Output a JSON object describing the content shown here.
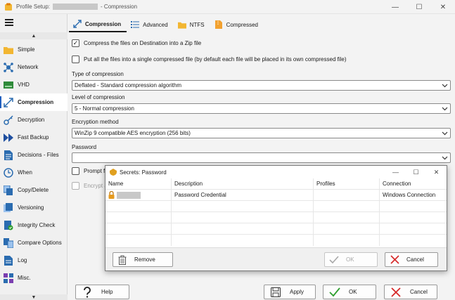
{
  "window": {
    "title_prefix": "Profile Setup:",
    "title_suffix": "- Compression",
    "minimize": "—",
    "maximize": "☐",
    "close": "✕"
  },
  "sidebar": {
    "scroll_up": "▲",
    "scroll_down": "▼",
    "items": [
      {
        "label": "Simple",
        "icon": "folder-icon"
      },
      {
        "label": "Network",
        "icon": "network-icon"
      },
      {
        "label": "VHD",
        "icon": "vhd-icon"
      },
      {
        "label": "Compression",
        "icon": "compression-icon",
        "active": true
      },
      {
        "label": "Decryption",
        "icon": "key-icon"
      },
      {
        "label": "Fast Backup",
        "icon": "fast-forward-icon"
      },
      {
        "label": "Decisions - Files",
        "icon": "document-icon"
      },
      {
        "label": "When",
        "icon": "clock-icon"
      },
      {
        "label": "Copy/Delete",
        "icon": "copy-icon"
      },
      {
        "label": "Versioning",
        "icon": "versioning-icon"
      },
      {
        "label": "Integrity Check",
        "icon": "integrity-icon"
      },
      {
        "label": "Compare Options",
        "icon": "compare-icon"
      },
      {
        "label": "Log",
        "icon": "log-icon"
      },
      {
        "label": "Misc.",
        "icon": "misc-icon"
      }
    ]
  },
  "tabs": [
    {
      "label": "Compression",
      "active": true
    },
    {
      "label": "Advanced"
    },
    {
      "label": "NTFS"
    },
    {
      "label": "Compressed"
    }
  ],
  "compression": {
    "zip_checkbox_label": "Compress the files on Destination into a Zip file",
    "zip_checked": true,
    "single_file_label": "Put all the files into a single compressed file (by default each file will be placed in its own compressed file)",
    "single_file_checked": false,
    "type_label": "Type of compression",
    "type_value": "Deflated - Standard compression algorithm",
    "level_label": "Level of compression",
    "level_value": "5 - Normal compression",
    "encryption_label": "Encryption method",
    "encryption_value": "WinZip 9 compatible AES encryption (256 bits)",
    "password_label": "Password",
    "password_value": "",
    "prompt_label": "Prompt fo",
    "encrypt_label": "Encrypt an"
  },
  "buttons": {
    "help": "Help",
    "apply": "Apply",
    "ok": "OK",
    "cancel": "Cancel"
  },
  "dialog": {
    "title": "Secrets: Password",
    "columns": [
      "Name",
      "Description",
      "Profiles",
      "Connection"
    ],
    "rows": [
      {
        "name": "",
        "description": "Password Credential",
        "profiles": "",
        "connection": "Windows Connection"
      }
    ],
    "remove": "Remove",
    "ok": "OK",
    "cancel": "Cancel"
  },
  "colors": {
    "accent": "#1f5fbf",
    "cancel_red": "#d62828",
    "ok_green": "#2e9e2e",
    "folder_yellow": "#f2b632"
  }
}
